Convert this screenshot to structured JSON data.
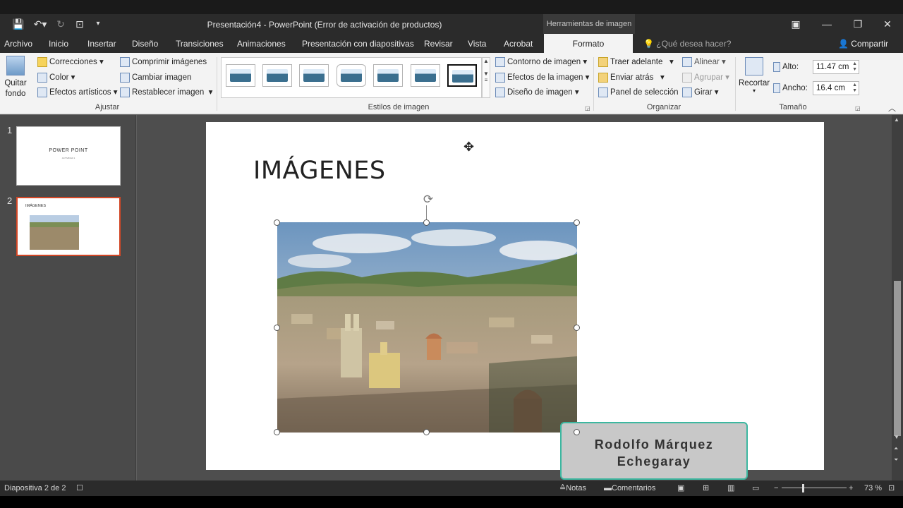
{
  "window": {
    "title": "Presentación4 - PowerPoint (Error de activación de productos)",
    "contextual_tab_group": "Herramientas de imagen"
  },
  "tabs": [
    "Archivo",
    "Inicio",
    "Insertar",
    "Diseño",
    "Transiciones",
    "Animaciones",
    "Presentación con diapositivas",
    "Revisar",
    "Vista",
    "Acrobat",
    "Formato"
  ],
  "tell_me": "¿Qué desea hacer?",
  "share": "Compartir",
  "ribbon": {
    "remove_bg": [
      "Quitar",
      "fondo"
    ],
    "corrections": "Correcciones",
    "color": "Color",
    "artistic": "Efectos artísticos",
    "compress": "Comprimir imágenes",
    "change": "Cambiar imagen",
    "reset": "Restablecer imagen",
    "group_adjust": "Ajustar",
    "group_styles": "Estilos de imagen",
    "border": "Contorno de imagen",
    "effects": "Efectos de la imagen",
    "layout": "Diseño de imagen",
    "bring_forward": "Traer adelante",
    "send_backward": "Enviar atrás",
    "selection_pane": "Panel de selección",
    "align": "Alinear",
    "group": "Agrupar",
    "rotate": "Girar",
    "group_arrange": "Organizar",
    "crop": "Recortar",
    "height_label": "Alto:",
    "height_value": "11.47 cm",
    "width_label": "Ancho:",
    "width_value": "16.4 cm",
    "group_size": "Tamaño"
  },
  "slides": [
    {
      "number": "1",
      "title": "POWER POINT",
      "subtitle": "ACTIVIDAD 1"
    },
    {
      "number": "2",
      "title": "IMÁGENES"
    }
  ],
  "slide": {
    "title": "IMÁGENES",
    "caption_line1": "Rodolfo Márquez",
    "caption_line2": "Echegaray"
  },
  "status": {
    "slide_info": "Diapositiva 2 de 2",
    "notes": "Notas",
    "comments": "Comentarios",
    "zoom": "73 %"
  }
}
